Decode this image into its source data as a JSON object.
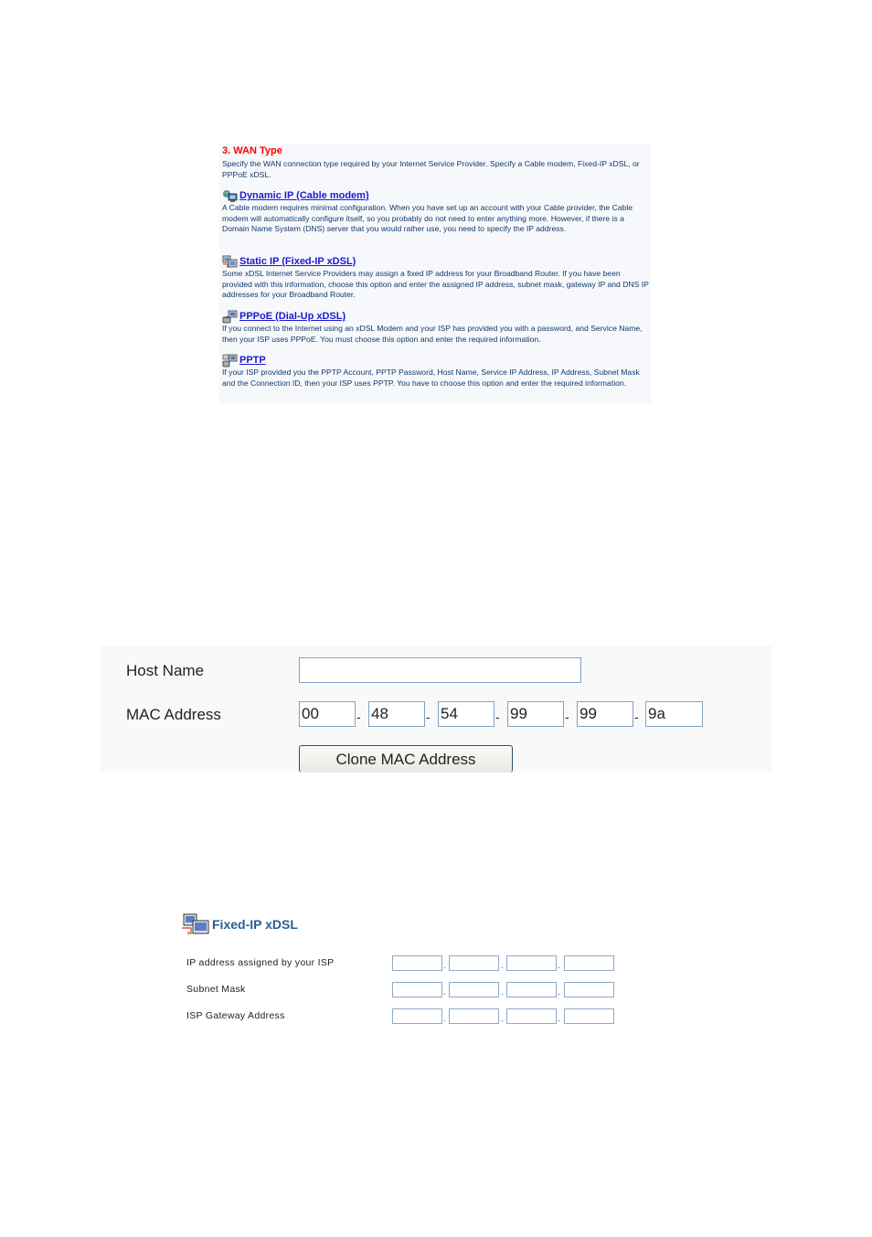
{
  "wan_type": {
    "title": "3. WAN Type",
    "description": "Specify the WAN connection type required by your Internet Service Provider. Specify a Cable modem, Fixed-IP xDSL, or PPPoE xDSL.",
    "options": [
      {
        "icon": "network-globe-icon",
        "label": "Dynamic IP (Cable modem)",
        "description": "A Cable modem requires minimal configuration. When you have set up an account with your Cable provider, the Cable modem will automatically configure itself, so you probably do not need to enter anything more. However, if there is a Domain Name System (DNS) server that you would rather use, you need to specify the IP address."
      },
      {
        "icon": "computers-icon",
        "label": "Static IP (Fixed-IP xDSL)",
        "description": "Some xDSL Internet Service Providers may assign a fixed IP address for your Broadband Router. If you have been provided with this information, choose this option and enter the assigned IP address, subnet mask, gateway IP and DNS IP addresses for your Broadband Router."
      },
      {
        "icon": "dialup-modem-icon",
        "label": "PPPoE (Dial-Up xDSL)",
        "description": "If you connect to the Internet using an xDSL Modem and your ISP has provided you with a password, and Service Name, then your ISP uses PPPoE. You must choose this option and enter the required information."
      },
      {
        "icon": "vpn-icon",
        "label": "PPTP",
        "description": "If your ISP provided you the PPTP Account, PPTP Password, Host Name, Service IP Address, IP Address, Subnet Mask and the Connection ID, then your ISP uses PPTP. You have to choose this option and enter the required information."
      }
    ]
  },
  "dynamic_form": {
    "host_name_label": "Host Name",
    "host_name_value": "",
    "mac_label": "MAC Address",
    "mac_separator": "-",
    "mac_values": [
      "00",
      "48",
      "54",
      "99",
      "99",
      "9a"
    ],
    "clone_button": "Clone MAC Address"
  },
  "fixed_ip_form": {
    "title": "Fixed-IP xDSL",
    "separator": ".",
    "rows": [
      {
        "label": "IP address assigned by your ISP",
        "values": [
          "",
          "",
          "",
          ""
        ]
      },
      {
        "label": "Subnet Mask",
        "values": [
          "",
          "",
          "",
          ""
        ]
      },
      {
        "label": "ISP Gateway Address",
        "values": [
          "",
          "",
          "",
          ""
        ]
      }
    ]
  }
}
